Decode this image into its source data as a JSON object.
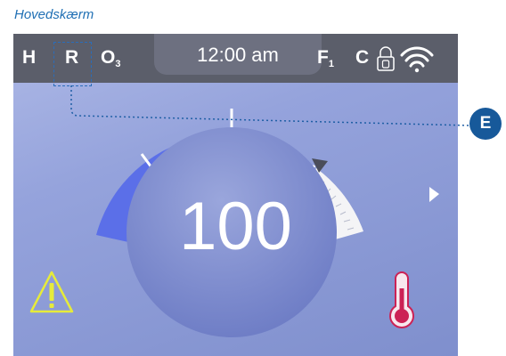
{
  "caption": "Hovedskærm",
  "status_bar": {
    "h": "H",
    "r": "R",
    "o": "O",
    "o_sub": "3",
    "time": "12:00 am",
    "f": "F",
    "f_sub": "1",
    "c": "C"
  },
  "gauge": {
    "value": "100",
    "level_fraction": 0.72
  },
  "callout": "E",
  "icons": {
    "lock": "lock-icon",
    "wifi": "wifi-icon",
    "arrow": "right-arrow-icon",
    "warning": "warning-icon",
    "thermometer": "thermometer-icon"
  },
  "colors": {
    "gauge_fill": "#5b6fe8",
    "warning": "#e6eb3a",
    "thermometer": "#cc2255",
    "callout": "#17599a"
  }
}
